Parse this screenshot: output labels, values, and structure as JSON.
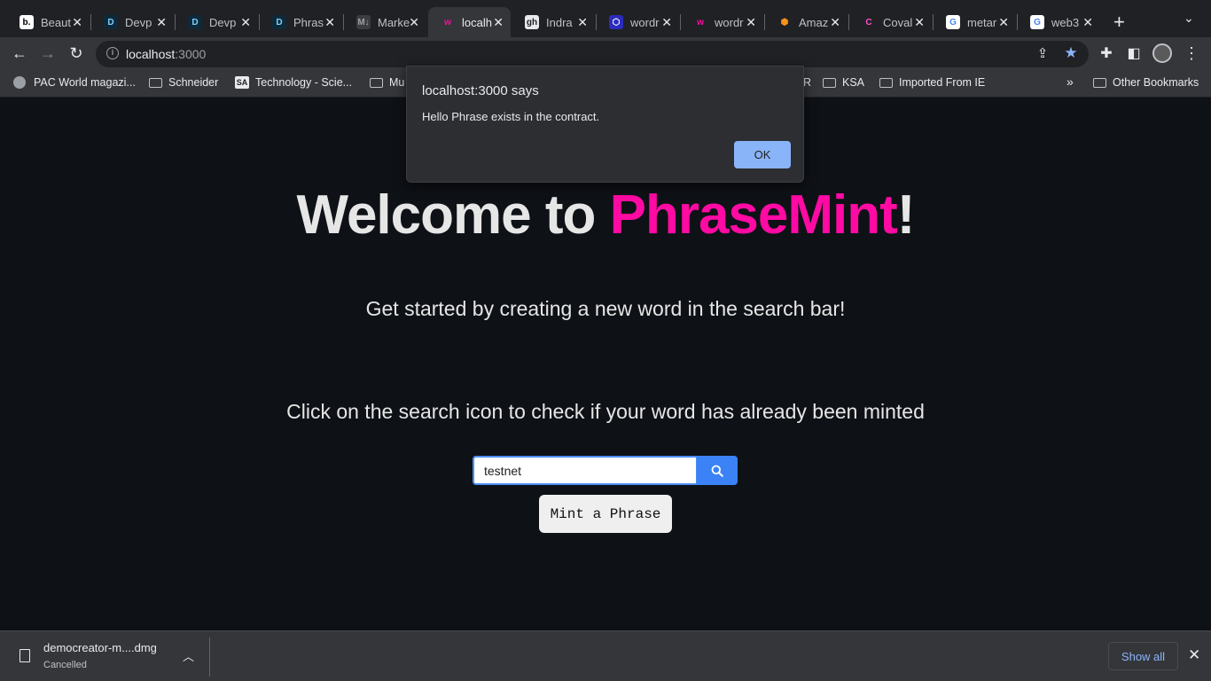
{
  "tabs": [
    {
      "title": "Beaut",
      "favicon": "b.",
      "favicon_bg": "#ffffff",
      "favicon_fg": "#000000"
    },
    {
      "title": "Devp",
      "favicon": "D",
      "favicon_bg": "#0e2a3a",
      "favicon_fg": "#7fd1ff"
    },
    {
      "title": "Devp",
      "favicon": "D",
      "favicon_bg": "#0e2a3a",
      "favicon_fg": "#7fd1ff"
    },
    {
      "title": "Phras",
      "favicon": "D",
      "favicon_bg": "#0e2a3a",
      "favicon_fg": "#7fd1ff"
    },
    {
      "title": "Marke",
      "favicon": "M↓",
      "favicon_bg": "#3c3d40",
      "favicon_fg": "#9aa0a6"
    },
    {
      "title": "localh",
      "favicon": "w",
      "favicon_bg": "#35363a",
      "favicon_fg": "#ff0aa3"
    },
    {
      "title": "Indra",
      "favicon": "gh",
      "favicon_bg": "#e8eaed",
      "favicon_fg": "#202124"
    },
    {
      "title": "wordr",
      "favicon": "⬡",
      "favicon_bg": "#2b2bbd",
      "favicon_fg": "#ffffff"
    },
    {
      "title": "wordr",
      "favicon": "w",
      "favicon_bg": "#202124",
      "favicon_fg": "#ff0aa3"
    },
    {
      "title": "Amaz",
      "favicon": "⬢",
      "favicon_bg": "#202124",
      "favicon_fg": "#f7931a"
    },
    {
      "title": "Coval",
      "favicon": "C",
      "favicon_bg": "#202124",
      "favicon_fg": "#ff4ecd"
    },
    {
      "title": "metar",
      "favicon": "G",
      "favicon_bg": "#ffffff",
      "favicon_fg": "#4285f4"
    },
    {
      "title": "web3",
      "favicon": "G",
      "favicon_bg": "#ffffff",
      "favicon_fg": "#4285f4"
    }
  ],
  "toolbar": {
    "url_host": "localhost",
    "url_port": ":3000"
  },
  "bookmarks": [
    {
      "label": "PAC World magazi...",
      "type": "site"
    },
    {
      "label": "Schneider",
      "type": "folder"
    },
    {
      "label": "Technology - Scie...",
      "type": "site"
    },
    {
      "label": "Mu",
      "type": "folder"
    },
    {
      "label": "R",
      "type": "text"
    },
    {
      "label": "KSA",
      "type": "folder"
    },
    {
      "label": "Imported From IE",
      "type": "folder"
    },
    {
      "label": "»",
      "type": "text"
    },
    {
      "label": "Other Bookmarks",
      "type": "folder"
    }
  ],
  "page": {
    "title_prefix": "Welcome to ",
    "title_brand": "PhraseMint",
    "title_suffix": "!",
    "subtitle": "Get started by creating a new word in the search bar!",
    "instruction": "Click on the search icon to check if your word has already been minted",
    "search_value": "testnet",
    "mint_button": "Mint a Phrase",
    "brand_color": "#ff0aa3"
  },
  "dialog": {
    "title": "localhost:3000 says",
    "message": "Hello Phrase exists in the contract.",
    "ok_label": "OK"
  },
  "download": {
    "filename": "democreator-m....dmg",
    "status": "Cancelled",
    "show_all": "Show all"
  }
}
